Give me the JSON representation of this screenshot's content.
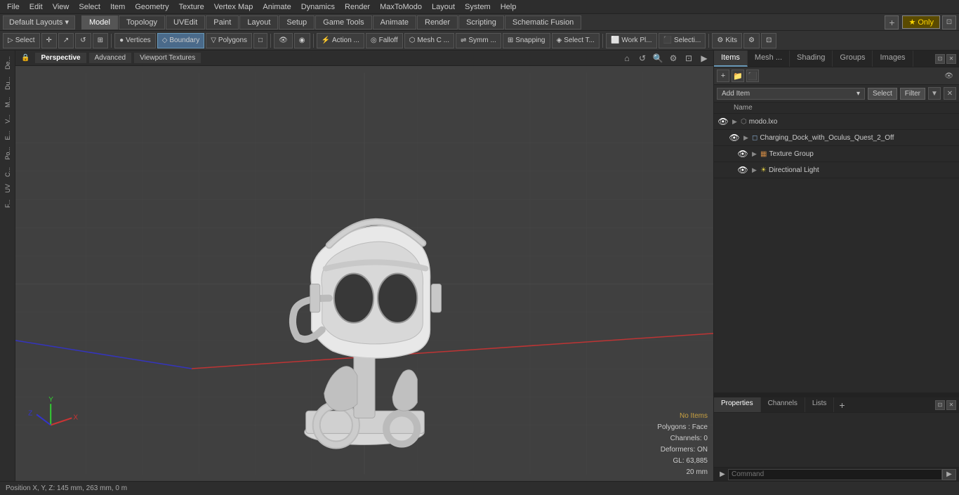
{
  "menuBar": {
    "items": [
      "File",
      "Edit",
      "View",
      "Select",
      "Item",
      "Geometry",
      "Texture",
      "Vertex Map",
      "Animate",
      "Dynamics",
      "Render",
      "MaxToModo",
      "Layout",
      "System",
      "Help"
    ]
  },
  "layoutBar": {
    "dropdown": "Default Layouts ▾",
    "tabs": [
      "Model",
      "Topology",
      "UVEdit",
      "Paint",
      "Layout",
      "Setup",
      "Game Tools",
      "Animate",
      "Render",
      "Scripting",
      "Schematic Fusion"
    ],
    "activeTab": "Model",
    "plusBtn": "+",
    "starBtn": "★ Only"
  },
  "toolbar": {
    "select_mode_label": "Select",
    "boundary_btn": "Boundary",
    "action_btn": "Action ...",
    "falloff_btn": "Falloff",
    "mesh_c_btn": "Mesh C ...",
    "symm_btn": "Symm ...",
    "snapping_btn": "⊞ Snapping",
    "select_t_btn": "Select T...",
    "work_pl_btn": "Work Pl...",
    "select_i_btn": "Selecti...",
    "kits_btn": "Kits"
  },
  "viewport": {
    "perspective_btn": "Perspective",
    "advanced_btn": "Advanced",
    "viewport_textures_btn": "Viewport Textures"
  },
  "leftSidebar": {
    "items": [
      "De...",
      "Du...",
      "M...",
      "V...",
      "E...",
      "Po...",
      "C...",
      "UV",
      "F..."
    ]
  },
  "viewportInfo": {
    "noItems": "No Items",
    "polygons": "Polygons : Face",
    "channels": "Channels: 0",
    "deformers": "Deformers: ON",
    "gl": "GL: 63,885",
    "mm": "20 mm"
  },
  "statusBar": {
    "position": "Position X, Y, Z:  145 mm, 263 mm, 0 m"
  },
  "rightPanel": {
    "tabs": [
      "Items",
      "Mesh ...",
      "Shading",
      "Groups",
      "Images"
    ],
    "activeTab": "Items",
    "addItem": "Add Item",
    "selectBtn": "Select",
    "filterBtn": "Filter",
    "nameHeader": "Name",
    "items": [
      {
        "id": "root",
        "name": "modo.lxo",
        "indent": 0,
        "type": "scene",
        "visible": true,
        "expanded": true
      },
      {
        "id": "mesh",
        "name": "Charging_Dock_with_Oculus_Quest_2_Off",
        "indent": 1,
        "type": "mesh",
        "visible": true,
        "expanded": false
      },
      {
        "id": "texgroup",
        "name": "Texture Group",
        "indent": 2,
        "type": "texture",
        "visible": true,
        "expanded": false
      },
      {
        "id": "light",
        "name": "Directional Light",
        "indent": 2,
        "type": "light",
        "visible": true,
        "expanded": false
      }
    ],
    "toolbarIcons": [
      "+",
      "×",
      "▲"
    ]
  },
  "bottomPanel": {
    "tabs": [
      "Properties",
      "Channels",
      "Lists"
    ],
    "activeTab": "Properties",
    "plusBtn": "+"
  },
  "commandBar": {
    "placeholder": "Command",
    "arrowLabel": "▶"
  },
  "colors": {
    "accent": "#6a9aba",
    "activeTab": "#3a5a7a",
    "warning": "#c8a040",
    "background": "#3a3a3a",
    "panel": "#2d2d2d",
    "border": "#222"
  }
}
